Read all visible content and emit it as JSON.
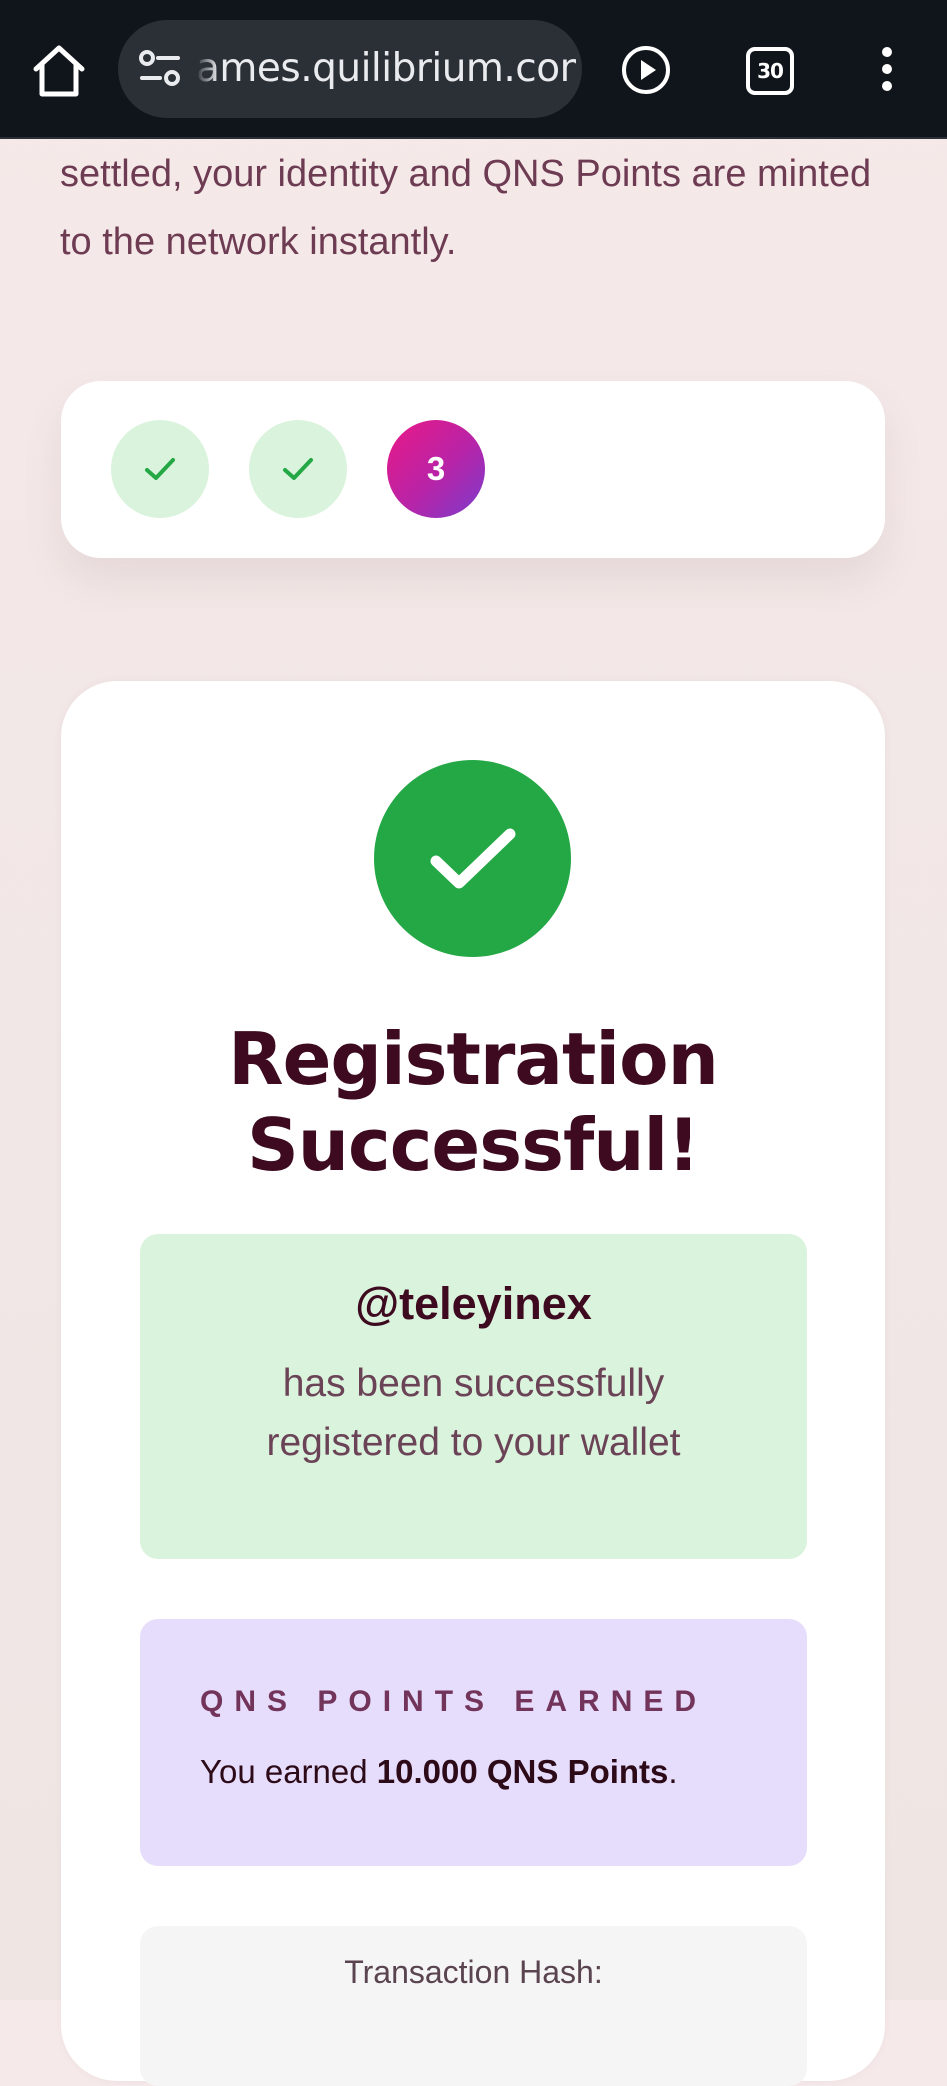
{
  "browser": {
    "url": "ames.quilibrium.com",
    "tab_count": "30",
    "icons": [
      "home-icon",
      "site-settings-icon",
      "play-icon",
      "tabs-icon",
      "more-menu-icon"
    ]
  },
  "intro_text": "settled, your identity and QNS Points are minted to the network instantly.",
  "steps": [
    {
      "status": "done",
      "icon": "check-icon"
    },
    {
      "status": "done",
      "icon": "check-icon"
    },
    {
      "status": "current",
      "label": "3"
    }
  ],
  "success": {
    "title_line1": "Registration",
    "title_line2": "Successful!",
    "username": "@teleyinex",
    "message": "has been successfully registered to your wallet",
    "points_heading": "QNS POINTS EARNED",
    "points_prefix": "You earned ",
    "points_value": "10.000 QNS Points",
    "points_suffix": ".",
    "tx_label": "Transaction Hash:"
  },
  "colors": {
    "success_green": "#24a845",
    "title_color": "#3d0a1f",
    "points_bg": "#e6dcfb",
    "registered_bg": "#daf3dc",
    "step_gradient_start": "#ea1886",
    "step_gradient_end": "#7a3dcc"
  }
}
